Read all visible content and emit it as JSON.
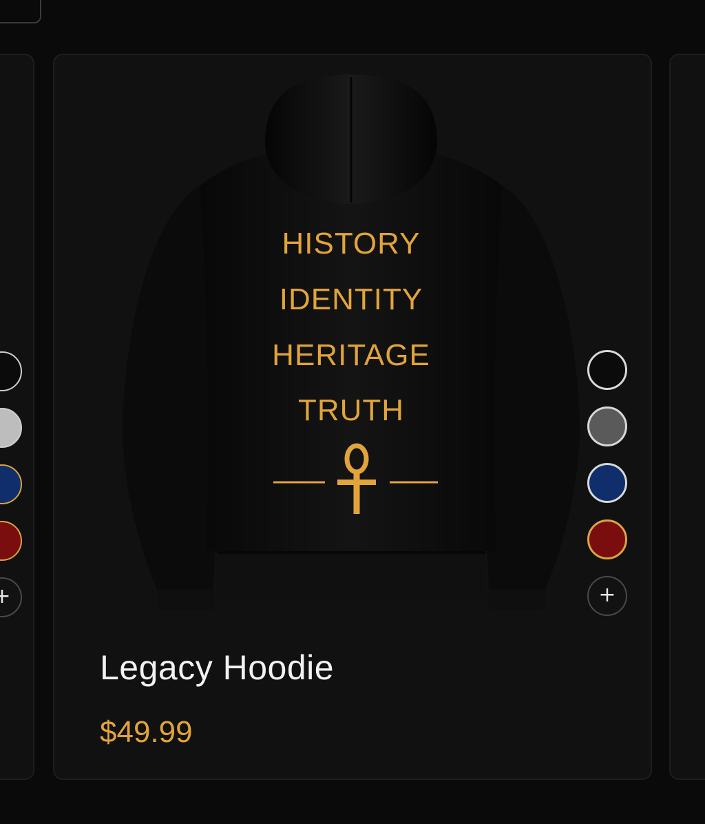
{
  "product": {
    "name": "Legacy Hoodie",
    "price": "$49.99"
  },
  "hoodie_print": {
    "lines": [
      "HISTORY",
      "IDENTITY",
      "HERITAGE",
      "TRUTH"
    ],
    "emblem": "ankh-icon"
  },
  "colors": {
    "accent_gold": "#e2a43a",
    "swatches": [
      {
        "name": "black",
        "hex": "#0b0b0b"
      },
      {
        "name": "gray",
        "hex": "#5a5a5a"
      },
      {
        "name": "navy",
        "hex": "#0f2e6b"
      },
      {
        "name": "burgundy",
        "hex": "#7a0d0d"
      }
    ]
  },
  "more_colors_label": "+"
}
